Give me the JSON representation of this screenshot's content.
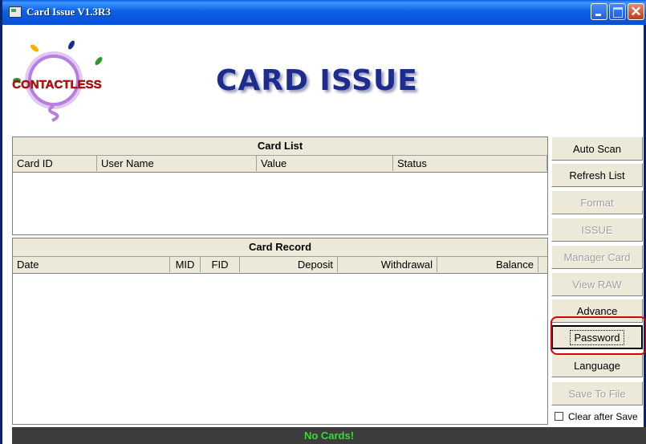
{
  "window": {
    "title": "Card Issue V1.3R3"
  },
  "logo": {
    "text": "CONTACTLESS"
  },
  "banner": {
    "text": "CARD ISSUE"
  },
  "card_list": {
    "title": "Card List",
    "columns": [
      "Card ID",
      "User Name",
      "Value",
      "Status"
    ]
  },
  "card_record": {
    "title": "Card Record",
    "columns": [
      "Date",
      "MID",
      "FID",
      "Deposit",
      "Withdrawal",
      "Balance"
    ]
  },
  "buttons": {
    "auto_scan": "Auto Scan",
    "refresh_list": "Refresh List",
    "format": "Format",
    "issue": "ISSUE",
    "manager_card": "Manager Card",
    "view_raw": "View RAW",
    "advance": "Advance",
    "password": "Password",
    "language": "Language",
    "save_to_file": "Save To File"
  },
  "clear_after_save": {
    "label": "Clear after Save",
    "checked": false
  },
  "status": {
    "text": "No Cards!",
    "color": "#33dd33"
  },
  "colors": {
    "highlight": "#dd0000",
    "banner": "#1f2c8f",
    "titlebar": "#0b61e3"
  }
}
